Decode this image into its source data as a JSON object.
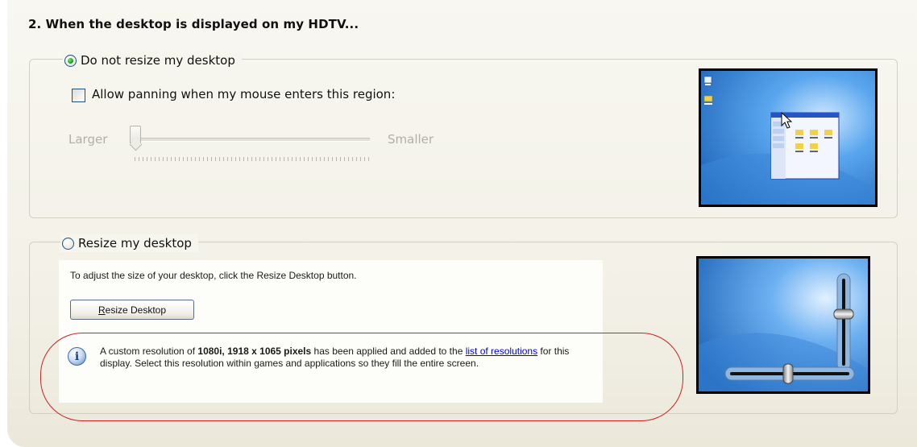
{
  "section": {
    "heading": "2. When the desktop is displayed on my HDTV..."
  },
  "option_no_resize": {
    "label": "Do not resize my desktop",
    "selected": true,
    "panning_checkbox_label": "Allow panning when my mouse enters this region:",
    "panning_checked": false,
    "slider_min_label": "Larger",
    "slider_max_label": "Smaller",
    "slider_enabled": false
  },
  "option_resize": {
    "label": "Resize my desktop",
    "selected": false,
    "instruction": "To adjust the size of your desktop, click the Resize Desktop button.",
    "button_label": "Resize Desktop",
    "button_mnemonic": "R",
    "info": {
      "icon": "info-icon",
      "icon_glyph": "i",
      "text_before": "A custom resolution of ",
      "text_bold": "1080i, 1918 x 1065 pixels",
      "text_middle": " has been applied and added to the ",
      "link_text": "list of resolutions",
      "text_after": " for this display. Select this resolution within games and applications so they fill the entire screen."
    }
  },
  "colors": {
    "highlight_ring": "#cc2222",
    "link": "#0000e0",
    "preview_blue": "#2f7fd0"
  }
}
